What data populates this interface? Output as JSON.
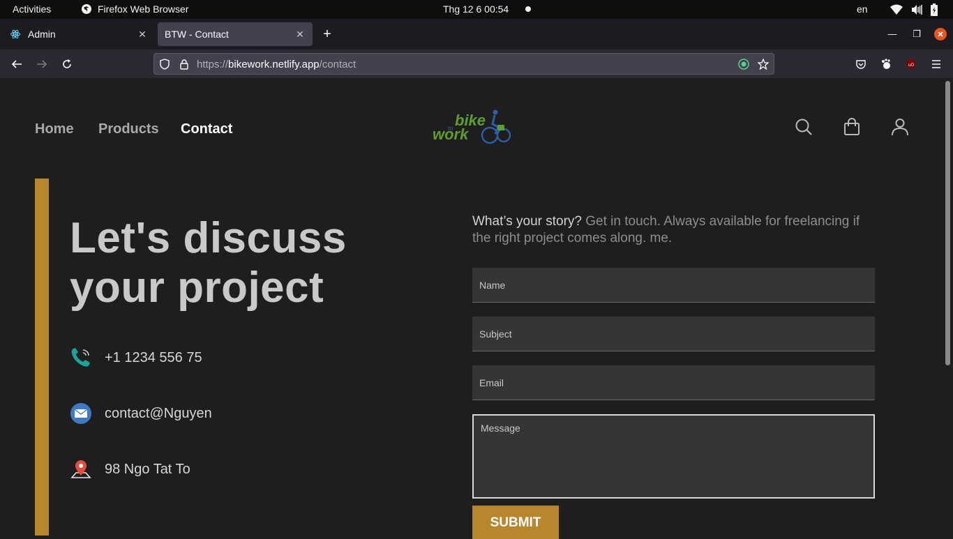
{
  "system_bar": {
    "activities": "Activities",
    "app_name": "Firefox Web Browser",
    "clock": "Thg 12 6  00:54",
    "language": "en"
  },
  "browser": {
    "tabs": [
      {
        "title": "Admin",
        "active": false,
        "icon": "react-icon"
      },
      {
        "title": "BTW - Contact",
        "active": true,
        "icon": "none"
      }
    ],
    "url_scheme": "https://",
    "url_host": "bikework.netlify.app",
    "url_path": "/contact",
    "accent_close": "#e95420"
  },
  "site": {
    "nav": {
      "home": "Home",
      "products": "Products",
      "contact": "Contact"
    },
    "logo": {
      "word1": "bike",
      "word2": "to",
      "word3": "work"
    },
    "header_icons": [
      "search-icon",
      "shopping-bag-icon",
      "user-icon"
    ],
    "headline_line1": "Let's discuss",
    "headline_line2": "your project",
    "contacts": {
      "phone": "+1 1234 556 75",
      "email": "contact@Nguyen",
      "address": "98 Ngo Tat To"
    },
    "intro_strong": "What’s your story?",
    "intro_rest": " Get in touch. Always available for freelancing if the right project comes along. me.",
    "form": {
      "name_placeholder": "Name",
      "subject_placeholder": "Subject",
      "email_placeholder": "Email",
      "message_placeholder": "Message",
      "submit_label": "SUBMIT"
    },
    "colors": {
      "accent": "#b8862b",
      "logo_green": "#5e9e2f",
      "logo_blue": "#2b5fa8"
    }
  }
}
